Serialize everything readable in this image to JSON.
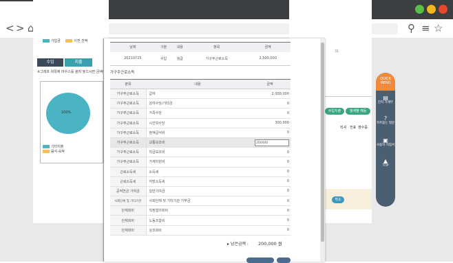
{
  "browser": {
    "tab_close": "×",
    "new_tab": "+",
    "back": "<",
    "forward": ">",
    "home": "⌂",
    "reload": "↻",
    "location_icon": "⚲",
    "menu": "≡",
    "star": "☆"
  },
  "left": {
    "legend_top": [
      "가입금",
      "이전 잔액"
    ],
    "tab_income": "수입",
    "tab_expense": "지출",
    "notice": "※그래프 위쪽에 마우스를 올려 놓으시면 금액이 표시됩니다",
    "pie_label": "100%",
    "legend_bottom": [
      "기타지출",
      "음식·숙박"
    ]
  },
  "right": {
    "green_buttons": [
      "수입지출",
      "월계별 예등"
    ],
    "headers": [
      "되셔",
      "전표",
      "영수증"
    ],
    "cancel_button": "취소",
    "side_number": "31"
  },
  "quick": {
    "title": "QUICK MENU",
    "items": [
      {
        "icon": "▤",
        "label": "전자 가계부"
      },
      {
        "icon": "?",
        "label": "자주묻는 질문"
      },
      {
        "icon": "▣",
        "label": "사용자 지침서"
      },
      {
        "icon": "▲",
        "label": "TOP"
      }
    ]
  },
  "modal": {
    "summary_headers": [
      "날짜",
      "구분",
      "내용",
      "항목",
      "금액"
    ],
    "summary_row": [
      "20210725",
      "수입",
      "월급",
      "가구주근로소득",
      "2,500,000"
    ],
    "section_title": "가구주근로소득",
    "detail_headers": [
      "분목",
      "내용",
      "금액"
    ],
    "rows": [
      [
        "가구주근로소득",
        "급여",
        "2,000,000"
      ],
      [
        "가구주근로소득",
        "상여수당/기타금",
        "0"
      ],
      [
        "가구주근로소득",
        "가족수당",
        "0"
      ],
      [
        "가구주근로소득",
        "시간외수당",
        "300,000"
      ],
      [
        "가구주근로소득",
        "정액급식비",
        "0"
      ],
      [
        "가구주근로소득",
        "교통보조비",
        "200000"
      ],
      [
        "가구주근로소득",
        "직급보조비",
        "0"
      ],
      [
        "가구주근로소득",
        "가계지원비",
        "0"
      ],
      [
        "근로소득세",
        "소득세",
        "0"
      ],
      [
        "근로소득세",
        "지방소득세",
        "0"
      ],
      [
        "공적연금 기여금",
        "일반기여금",
        "0"
      ],
      [
        "사회단체 및 기타기관",
        "사회단체 및 기타기관 기부금",
        "0"
      ],
      [
        "단체회비",
        "직장협의회비",
        "0"
      ],
      [
        "단체회비",
        "노동조합비",
        "0"
      ],
      [
        "단체회비",
        "상조회비",
        "0"
      ]
    ],
    "total_label": "▸ 남은금액 :",
    "total_value": "200,000 원"
  },
  "colors": {
    "accent": "#3aa0b0",
    "pie": "#4ab3c4",
    "quick_top": "#f08a3c",
    "quick_bg": "#4b5f72",
    "green": "#3aa57f"
  }
}
